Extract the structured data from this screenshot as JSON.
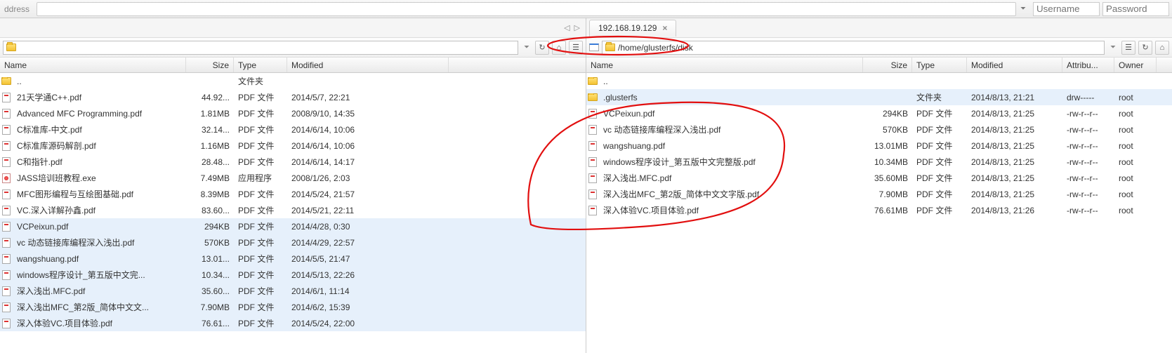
{
  "topbar": {
    "address_label": "ddress",
    "address_dropdown": "⏷",
    "username_placeholder": "Username",
    "password_placeholder": "Password"
  },
  "left": {
    "nav_prev": "◁",
    "nav_next": "▷",
    "path": "",
    "toolbar": {
      "refresh": "↻",
      "home": "⌂",
      "views": "☰"
    },
    "columns": {
      "name": "Name",
      "size": "Size",
      "type": "Type",
      "modified": "Modified"
    },
    "rows": [
      {
        "icon": "folder",
        "name": "..",
        "size": "",
        "type": "文件夹",
        "modified": ""
      },
      {
        "icon": "pdf",
        "name": "21天学通C++.pdf",
        "size": "44.92...",
        "type": "PDF 文件",
        "modified": "2014/5/7, 22:21"
      },
      {
        "icon": "pdf",
        "name": "Advanced MFC Programming.pdf",
        "size": "1.81MB",
        "type": "PDF 文件",
        "modified": "2008/9/10, 14:35"
      },
      {
        "icon": "pdf",
        "name": "C标准库-中文.pdf",
        "size": "32.14...",
        "type": "PDF 文件",
        "modified": "2014/6/14, 10:06"
      },
      {
        "icon": "pdf",
        "name": "C标准库源码解剖.pdf",
        "size": "1.16MB",
        "type": "PDF 文件",
        "modified": "2014/6/14, 10:06"
      },
      {
        "icon": "pdf",
        "name": "C和指针.pdf",
        "size": "28.48...",
        "type": "PDF 文件",
        "modified": "2014/6/14, 14:17"
      },
      {
        "icon": "exe",
        "name": "JASS培训班教程.exe",
        "size": "7.49MB",
        "type": "应用程序",
        "modified": "2008/1/26, 2:03"
      },
      {
        "icon": "pdf",
        "name": "MFC图形编程与互绘图基础.pdf",
        "size": "8.39MB",
        "type": "PDF 文件",
        "modified": "2014/5/24, 21:57"
      },
      {
        "icon": "pdf",
        "name": "VC.深入详解孙鑫.pdf",
        "size": "83.60...",
        "type": "PDF 文件",
        "modified": "2014/5/21, 22:11"
      },
      {
        "icon": "pdf",
        "name": "VCPeixun.pdf",
        "size": "294KB",
        "type": "PDF 文件",
        "modified": "2014/4/28, 0:30",
        "sel": true
      },
      {
        "icon": "pdf",
        "name": "vc 动态链接库编程深入浅出.pdf",
        "size": "570KB",
        "type": "PDF 文件",
        "modified": "2014/4/29, 22:57",
        "sel": true
      },
      {
        "icon": "pdf",
        "name": "wangshuang.pdf",
        "size": "13.01...",
        "type": "PDF 文件",
        "modified": "2014/5/5, 21:47",
        "sel": true
      },
      {
        "icon": "pdf",
        "name": "windows程序设计_第五版中文完...",
        "size": "10.34...",
        "type": "PDF 文件",
        "modified": "2014/5/13, 22:26",
        "sel": true
      },
      {
        "icon": "pdf",
        "name": "深入浅出.MFC.pdf",
        "size": "35.60...",
        "type": "PDF 文件",
        "modified": "2014/6/1, 11:14",
        "sel": true
      },
      {
        "icon": "pdf",
        "name": "深入浅出MFC_第2版_简体中文文...",
        "size": "7.90MB",
        "type": "PDF 文件",
        "modified": "2014/6/2, 15:39",
        "sel": true
      },
      {
        "icon": "pdf",
        "name": "深入体验VC.项目体验.pdf",
        "size": "76.61...",
        "type": "PDF 文件",
        "modified": "2014/5/24, 22:00",
        "sel": true
      }
    ]
  },
  "right": {
    "tab_label": "192.168.19.129",
    "tab_close": "×",
    "path": "/home/glusterfs/disk",
    "toolbar": {
      "views": "☰",
      "refresh": "↻",
      "home": "⌂"
    },
    "columns": {
      "name": "Name",
      "size": "Size",
      "type": "Type",
      "modified": "Modified",
      "attr": "Attribu...",
      "owner": "Owner"
    },
    "rows": [
      {
        "icon": "folder",
        "name": "..",
        "size": "",
        "type": "",
        "modified": "",
        "attr": "",
        "owner": ""
      },
      {
        "icon": "folder",
        "name": ".glusterfs",
        "size": "",
        "type": "文件夹",
        "modified": "2014/8/13, 21:21",
        "attr": "drw-----",
        "owner": "root",
        "sel": true
      },
      {
        "icon": "pdf",
        "name": "VCPeixun.pdf",
        "size": "294KB",
        "type": "PDF 文件",
        "modified": "2014/8/13, 21:25",
        "attr": "-rw-r--r--",
        "owner": "root"
      },
      {
        "icon": "pdf",
        "name": "vc 动态链接库编程深入浅出.pdf",
        "size": "570KB",
        "type": "PDF 文件",
        "modified": "2014/8/13, 21:25",
        "attr": "-rw-r--r--",
        "owner": "root"
      },
      {
        "icon": "pdf",
        "name": "wangshuang.pdf",
        "size": "13.01MB",
        "type": "PDF 文件",
        "modified": "2014/8/13, 21:25",
        "attr": "-rw-r--r--",
        "owner": "root"
      },
      {
        "icon": "pdf",
        "name": "windows程序设计_第五版中文完整版.pdf",
        "size": "10.34MB",
        "type": "PDF 文件",
        "modified": "2014/8/13, 21:25",
        "attr": "-rw-r--r--",
        "owner": "root"
      },
      {
        "icon": "pdf",
        "name": "深入浅出.MFC.pdf",
        "size": "35.60MB",
        "type": "PDF 文件",
        "modified": "2014/8/13, 21:25",
        "attr": "-rw-r--r--",
        "owner": "root"
      },
      {
        "icon": "pdf",
        "name": "深入浅出MFC_第2版_简体中文文字版.pdf",
        "size": "7.90MB",
        "type": "PDF 文件",
        "modified": "2014/8/13, 21:25",
        "attr": "-rw-r--r--",
        "owner": "root"
      },
      {
        "icon": "pdf",
        "name": "深入体验VC.项目体验.pdf",
        "size": "76.61MB",
        "type": "PDF 文件",
        "modified": "2014/8/13, 21:26",
        "attr": "-rw-r--r--",
        "owner": "root"
      }
    ]
  }
}
